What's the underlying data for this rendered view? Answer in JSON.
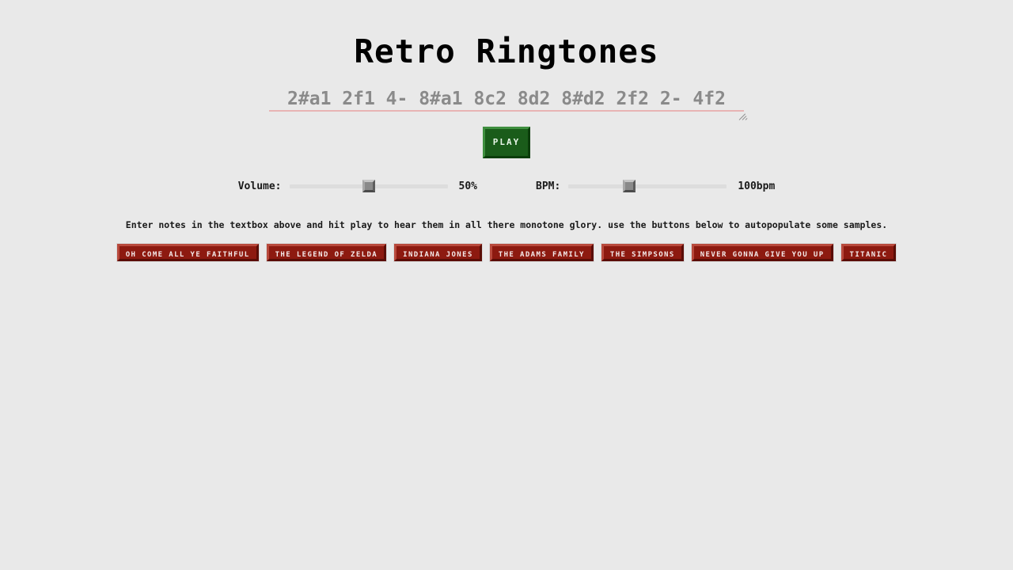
{
  "page": {
    "title": "Retro Ringtones",
    "background_color": "#e9e9e9"
  },
  "note_input": {
    "name": "note-sequence-input",
    "value": "",
    "placeholder": "2#a1 2f1 4- 8#a1 8c2 8d2 8#d2 2f2 2- 4f2"
  },
  "play": {
    "label": "PLAY",
    "color": "#1a5c1a"
  },
  "controls": {
    "volume": {
      "label": "Volume:",
      "value": 50,
      "value_text": "50%",
      "min": 0,
      "max": 100
    },
    "bpm": {
      "label": "BPM:",
      "value": 100,
      "value_text": "100bpm",
      "min": 40,
      "max": 200
    }
  },
  "description": "Enter notes in the textbox above and hit play to hear them in all there monotone glory. use the buttons below to autopopulate some samples.",
  "samples": {
    "accent_color": "#8d1a10",
    "items": [
      {
        "label": "OH COME ALL YE FAITHFUL"
      },
      {
        "label": "THE LEGEND OF ZELDA"
      },
      {
        "label": "INDIANA JONES"
      },
      {
        "label": "THE ADAMS FAMILY"
      },
      {
        "label": "THE SIMPSONS"
      },
      {
        "label": "NEVER GONNA GIVE YOU UP"
      },
      {
        "label": "TITANIC"
      }
    ]
  }
}
